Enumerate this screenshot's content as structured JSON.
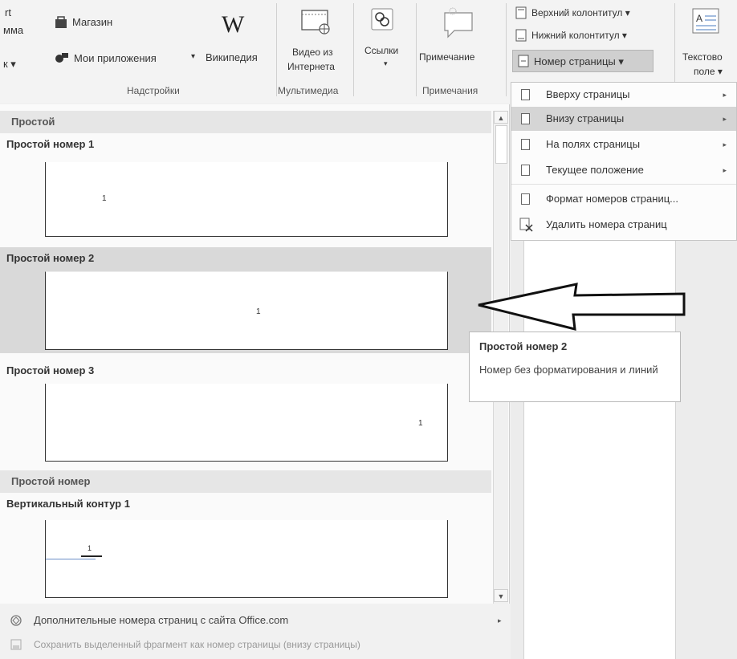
{
  "ribbon": {
    "left_partial_1": "rt",
    "left_partial_2": "мма",
    "left_partial_3": "к ▾",
    "store": "Магазин",
    "my_apps": "Мои приложения",
    "my_apps_arrow": "▾",
    "wiki": "Википедия",
    "wiki_logo": "W",
    "addins_group": "Надстройки",
    "video_line1": "Видео из",
    "video_line2": "Интернета",
    "media_group": "Мультимедиа",
    "links": "Ссылки",
    "links_arrow": "▾",
    "comment": "Примечание",
    "comments_group": "Примечания",
    "header": "Верхний колонтитул ▾",
    "footer": "Нижний колонтитул ▾",
    "page_number": "Номер страницы ▾",
    "textbox_line1": "Текстово",
    "textbox_line2": "поле ▾"
  },
  "menu": {
    "items": [
      {
        "label": "Вверху страницы",
        "arrow": "▸"
      },
      {
        "label": "Внизу страницы",
        "arrow": "▸"
      },
      {
        "label": "На полях страницы",
        "arrow": "▸"
      },
      {
        "label": "Текущее положение",
        "arrow": "▸"
      },
      {
        "label": "Формат номеров страниц..."
      },
      {
        "label": "Удалить номера страниц"
      }
    ]
  },
  "gallery": {
    "section1": "Простой",
    "item1": "Простой номер 1",
    "item2": "Простой номер 2",
    "item3": "Простой номер 3",
    "section2": "Простой номер",
    "item4": "Вертикальный контур 1",
    "page_mark": "1",
    "vertical_mark": "1",
    "scroll_up": "▲",
    "scroll_down": "▼",
    "more_online": "Дополнительные номера страниц с сайта Office.com",
    "more_arrow": "▸",
    "save_selection": "Сохранить выделенный фрагмент как номер страницы (внизу страницы)"
  },
  "tooltip": {
    "title": "Простой номер 2",
    "description": "Номер без форматирования и линий"
  },
  "colors": {
    "highlight": "#d9d9d9",
    "menu_hover": "#d5d5d5"
  }
}
